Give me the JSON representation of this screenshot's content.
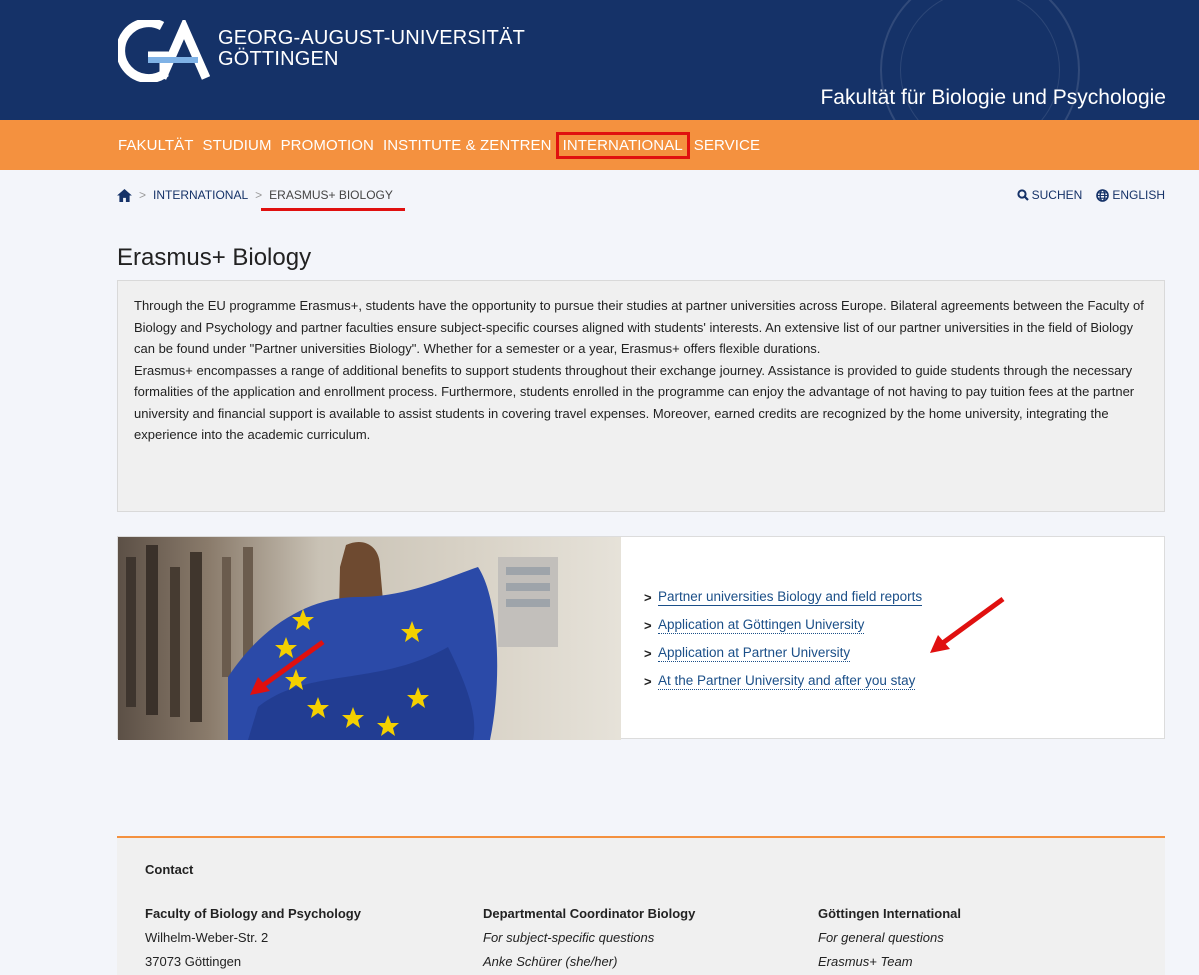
{
  "header": {
    "university_line1": "GEORG-AUGUST-UNIVERSITÄT",
    "university_line2": "GÖTTINGEN",
    "faculty_title": "Fakultät für Biologie und Psychologie"
  },
  "nav": {
    "items": [
      {
        "label": "FAKULTÄT"
      },
      {
        "label": "STUDIUM"
      },
      {
        "label": "PROMOTION"
      },
      {
        "label": "INSTITUTE & ZENTREN"
      },
      {
        "label": "INTERNATIONAL"
      },
      {
        "label": "SERVICE"
      }
    ]
  },
  "breadcrumb": {
    "items": [
      "INTERNATIONAL",
      "ERASMUS+ BIOLOGY"
    ]
  },
  "utility": {
    "search_label": "SUCHEN",
    "language_label": "ENGLISH"
  },
  "page": {
    "title": "Erasmus+ Biology",
    "intro_p1": "Through the EU programme Erasmus+, students have the opportunity to pursue their studies at partner universities across Europe. Bilateral agreements between the Faculty of Biology and Psychology and partner faculties ensure subject-specific courses aligned with students' interests. An extensive list of our partner universities in the field of Biology can be found under \"Partner universities Biology\". Whether for a semester or a year, Erasmus+ offers flexible durations.",
    "intro_p2": "Erasmus+ encompasses a range of additional benefits to support students throughout their exchange journey. Assistance is provided to guide students through the necessary formalities of the application and enrollment process. Furthermore, students enrolled in the programme can enjoy the advantage of not having to pay tuition fees at the partner university and financial support is available to assist students in covering travel expenses. Moreover, earned credits are recognized by the home university, integrating the experience into the academic curriculum."
  },
  "feature_links": [
    {
      "label": "Partner universities Biology and field reports"
    },
    {
      "label": "Application at Göttingen University"
    },
    {
      "label": "Application at Partner University"
    },
    {
      "label": "At the Partner University and after you stay"
    }
  ],
  "footer": {
    "heading": "Contact",
    "columns": [
      {
        "title": "Faculty of Biology and Psychology",
        "line1": "Wilhelm-Weber-Str. 2",
        "line2": "37073 Göttingen"
      },
      {
        "title": "Departmental Coordinator Biology",
        "line1": "For subject-specific questions",
        "line2": "Anke Schürer (she/her)"
      },
      {
        "title": "Göttingen International",
        "line1": "For general questions",
        "line2": "Erasmus+ Team"
      }
    ]
  },
  "colors": {
    "header_blue": "#153268",
    "nav_orange": "#f4913f",
    "highlight_red": "#e0100f",
    "link_blue": "#1b4f88"
  }
}
